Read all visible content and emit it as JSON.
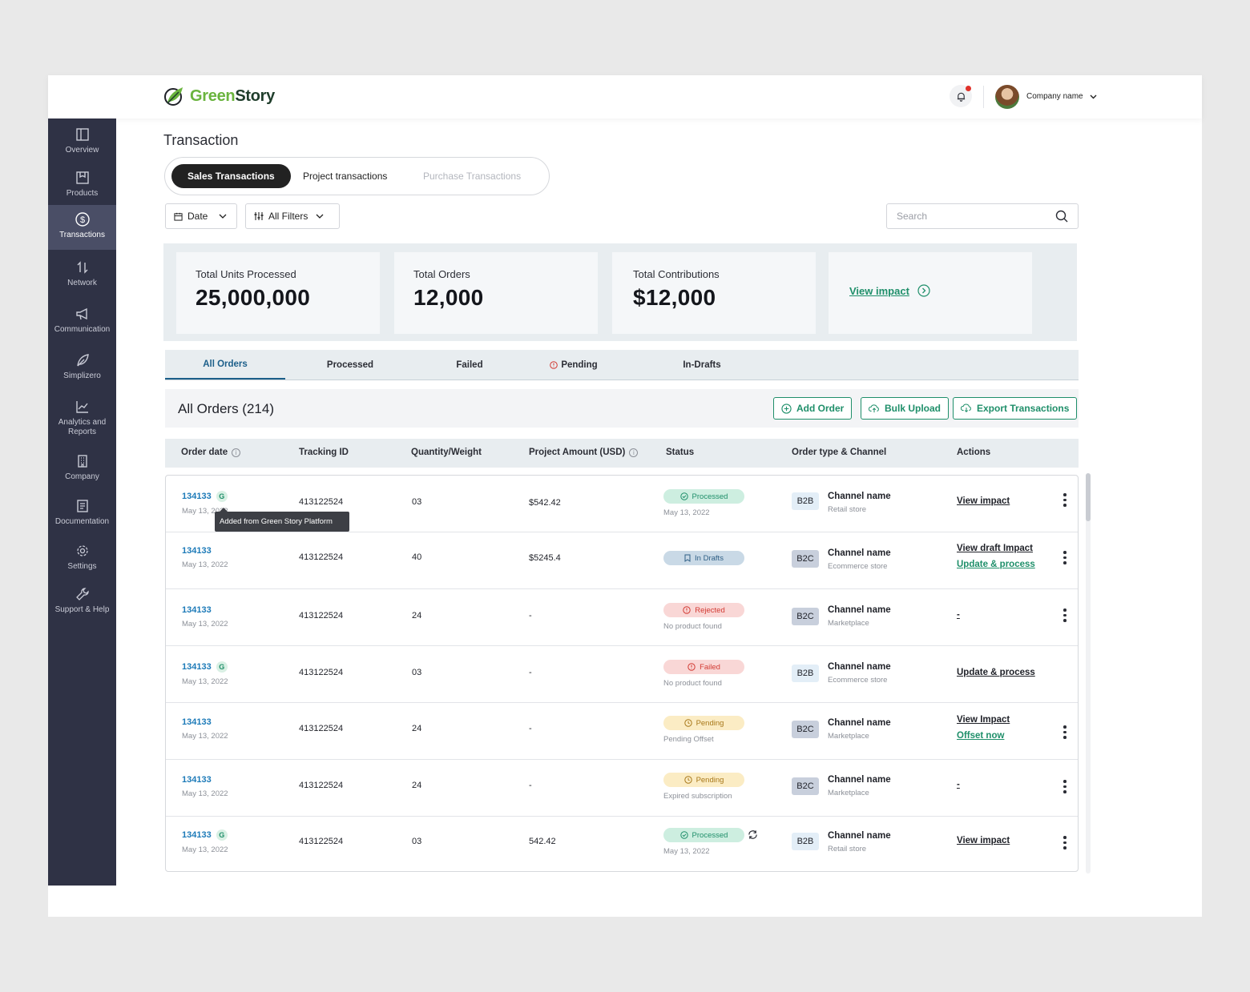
{
  "brand": {
    "name_part1": "Green",
    "name_part2": "Story"
  },
  "header": {
    "company_name": "Company name",
    "notification_dot_color": "#e0312a"
  },
  "sidebar": {
    "items": [
      {
        "label": "Overview",
        "icon": "layout-icon"
      },
      {
        "label": "Products",
        "icon": "box-icon"
      },
      {
        "label": "Transactions",
        "icon": "dollar-circle-icon",
        "active": true
      },
      {
        "label": "Network",
        "icon": "swap-icon"
      },
      {
        "label": "Communication",
        "icon": "megaphone-icon"
      },
      {
        "label": "Simplizero",
        "icon": "leaf-icon"
      },
      {
        "label": "Analytics and Reports",
        "icon": "chart-icon"
      },
      {
        "label": "Company",
        "icon": "building-icon"
      },
      {
        "label": "Documentation",
        "icon": "document-icon"
      },
      {
        "label": "Settings",
        "icon": "gear-icon"
      },
      {
        "label": "Support & Help",
        "icon": "wrench-icon"
      }
    ]
  },
  "page": {
    "title": "Transaction"
  },
  "segments": {
    "sales": "Sales Transactions",
    "project": "Project transactions",
    "purchase": "Purchase Transactions"
  },
  "filters": {
    "date_label": "Date",
    "all_filters_label": "All Filters",
    "search_placeholder": "Search"
  },
  "stats": {
    "units_label": "Total Units Processed",
    "units_value": "25,000,000",
    "orders_label": "Total Orders",
    "orders_value": "12,000",
    "contrib_label": "Total Contributions",
    "contrib_value": "$12,000",
    "view_impact": "View impact"
  },
  "order_tabs": {
    "all": "All Orders",
    "processed": "Processed",
    "failed": "Failed",
    "pending": "Pending",
    "drafts": "In-Drafts"
  },
  "orders": {
    "title": "All Orders (214)",
    "add_order": "Add Order",
    "bulk_upload": "Bulk Upload",
    "export": "Export Transactions"
  },
  "table": {
    "headers": {
      "order_date": "Order date",
      "tracking_id": "Tracking ID",
      "quantity": "Quantity/Weight",
      "amount": "Project Amount (USD)",
      "status": "Status",
      "order_type": "Order type & Channel",
      "actions": "Actions"
    },
    "tooltip": "Added from Green Story Platform",
    "rows": [
      {
        "id": "134133",
        "g": true,
        "date": "May 13, 2022",
        "tracking": "413122524",
        "qty": "03",
        "amount": "$542.42",
        "status": "Processed",
        "status_sub": "May 13, 2022",
        "type": "B2B",
        "channel": "Channel name",
        "channel_sub": "Retail store",
        "action1": "View impact",
        "action2": ""
      },
      {
        "id": "134133",
        "g": false,
        "date": "May 13, 2022",
        "tracking": "413122524",
        "qty": "40",
        "amount": "$5245.4",
        "status": "In Drafts",
        "status_sub": "",
        "type": "B2C",
        "channel": "Channel name",
        "channel_sub": "Ecommerce store",
        "action1": "View draft Impact",
        "action2": "Update & process"
      },
      {
        "id": "134133",
        "g": false,
        "date": "May 13, 2022",
        "tracking": "413122524",
        "qty": "24",
        "amount": "-",
        "status": "Rejected",
        "status_sub": "No product found",
        "type": "B2C",
        "channel": "Channel name",
        "channel_sub": "Marketplace",
        "action1": "-",
        "action2": ""
      },
      {
        "id": "134133",
        "g": true,
        "date": "May 13, 2022",
        "tracking": "413122524",
        "qty": "03",
        "amount": "-",
        "status": "Failed",
        "status_sub": "No product found",
        "type": "B2B",
        "channel": "Channel name",
        "channel_sub": "Ecommerce store",
        "action1": "Update & process",
        "action2": ""
      },
      {
        "id": "134133",
        "g": false,
        "date": "May 13, 2022",
        "tracking": "413122524",
        "qty": "24",
        "amount": "-",
        "status": "Pending",
        "status_sub": "Pending Offset",
        "type": "B2C",
        "channel": "Channel name",
        "channel_sub": "Marketplace",
        "action1": "View Impact",
        "action2": "Offset now"
      },
      {
        "id": "134133",
        "g": false,
        "date": "May 13, 2022",
        "tracking": "413122524",
        "qty": "24",
        "amount": "-",
        "status": "Pending",
        "status_sub": "Expired subscription",
        "type": "B2C",
        "channel": "Channel name",
        "channel_sub": "Marketplace",
        "action1": "-",
        "action2": ""
      },
      {
        "id": "134133",
        "g": true,
        "date": "May 13, 2022",
        "tracking": "413122524",
        "qty": "03",
        "amount": "542.42",
        "status": "Processed",
        "status_sub": "May 13, 2022",
        "type": "B2B",
        "channel": "Channel name",
        "channel_sub": "Retail store",
        "action1": "View impact",
        "action2": ""
      }
    ]
  },
  "colors": {
    "sidebar_bg": "#2f3245",
    "accent_green": "#1f8f6a",
    "link_blue": "#1c7ab8",
    "brand_green": "#6ab43e"
  }
}
